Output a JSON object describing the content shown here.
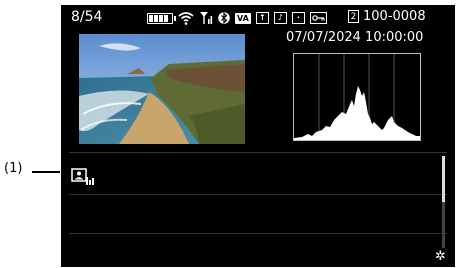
{
  "header": {
    "frame_count": "8/54",
    "folder_file": "100-0008",
    "card_slot": "2",
    "datetime": "07/07/2024 10:00:00",
    "status_icons": [
      "battery-icon",
      "wifi-icon",
      "signal-icon",
      "bluetooth-icon",
      "va-icon",
      "upload-icon",
      "music-note-icon",
      "focus-bracket-icon",
      "protect-key-icon"
    ]
  },
  "annotation": {
    "label": "(1)"
  },
  "info_icon": "image-info-icon",
  "scroll": {
    "position_fraction": 0.0,
    "visible_fraction": 0.5
  },
  "colors": {
    "screen_bg": "#000000",
    "text": "#ffffff"
  }
}
